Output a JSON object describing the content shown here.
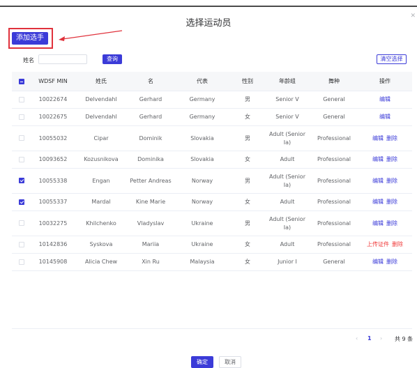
{
  "dialog": {
    "title": "选择运动员"
  },
  "toolbar": {
    "add_label": "添加选手"
  },
  "filter": {
    "name_label": "姓名",
    "name_value": "",
    "query_label": "查询",
    "clear_label": "清空选择"
  },
  "table": {
    "headers": [
      "WDSF MIN",
      "姓氏",
      "名",
      "代表",
      "性别",
      "年龄组",
      "舞种",
      "操作"
    ],
    "rows": [
      {
        "checked": false,
        "min": "10022674",
        "last": "Delvendahl",
        "first": "Gerhard",
        "country": "Germany",
        "gender": "男",
        "age_group": "Senior V",
        "dance": "General",
        "actions": [
          "编辑"
        ]
      },
      {
        "checked": false,
        "min": "10022675",
        "last": "Delvendahl",
        "first": "Gerhard",
        "country": "Germany",
        "gender": "女",
        "age_group": "Senior V",
        "dance": "General",
        "actions": [
          "编辑"
        ]
      },
      {
        "checked": false,
        "min": "10055032",
        "last": "Cipar",
        "first": "Dominik",
        "country": "Slovakia",
        "gender": "男",
        "age_group": "Adult (Senior Ia)",
        "dance": "Professional",
        "actions": [
          "编辑",
          "删除"
        ]
      },
      {
        "checked": false,
        "min": "10093652",
        "last": "Kozusnikova",
        "first": "Dominika",
        "country": "Slovakia",
        "gender": "女",
        "age_group": "Adult",
        "dance": "Professional",
        "actions": [
          "编辑",
          "删除"
        ]
      },
      {
        "checked": true,
        "min": "10055338",
        "last": "Engan",
        "first": "Petter Andreas",
        "country": "Norway",
        "gender": "男",
        "age_group": "Adult (Senior Ia)",
        "dance": "Professional",
        "actions": [
          "编辑",
          "删除"
        ]
      },
      {
        "checked": true,
        "min": "10055337",
        "last": "Mardal",
        "first": "Kine Marie",
        "country": "Norway",
        "gender": "女",
        "age_group": "Adult",
        "dance": "Professional",
        "actions": [
          "编辑",
          "删除"
        ]
      },
      {
        "checked": false,
        "min": "10032275",
        "last": "Khilchenko",
        "first": "Vladyslav",
        "country": "Ukraine",
        "gender": "男",
        "age_group": "Adult (Senior Ia)",
        "dance": "Professional",
        "actions": [
          "编辑",
          "删除"
        ]
      },
      {
        "checked": false,
        "min": "10142836",
        "last": "Syskova",
        "first": "Mariia",
        "country": "Ukraine",
        "gender": "女",
        "age_group": "Adult",
        "dance": "Professional",
        "actions": [
          "上传证件",
          "删除"
        ],
        "disabled": true
      },
      {
        "checked": false,
        "min": "10145908",
        "last": "Alicia Chew",
        "first": "Xin Ru",
        "country": "Malaysia",
        "gender": "女",
        "age_group": "Junior I",
        "dance": "General",
        "actions": [
          "编辑",
          "删除"
        ]
      }
    ]
  },
  "pagination": {
    "prev": "‹",
    "current": "1",
    "next": "›",
    "total": "共 9 条"
  },
  "footer": {
    "confirm": "确定",
    "cancel": "取消"
  },
  "colors": {
    "accent": "#3b3bd8",
    "danger": "#f03c3c",
    "annotation": "#e0323c"
  }
}
